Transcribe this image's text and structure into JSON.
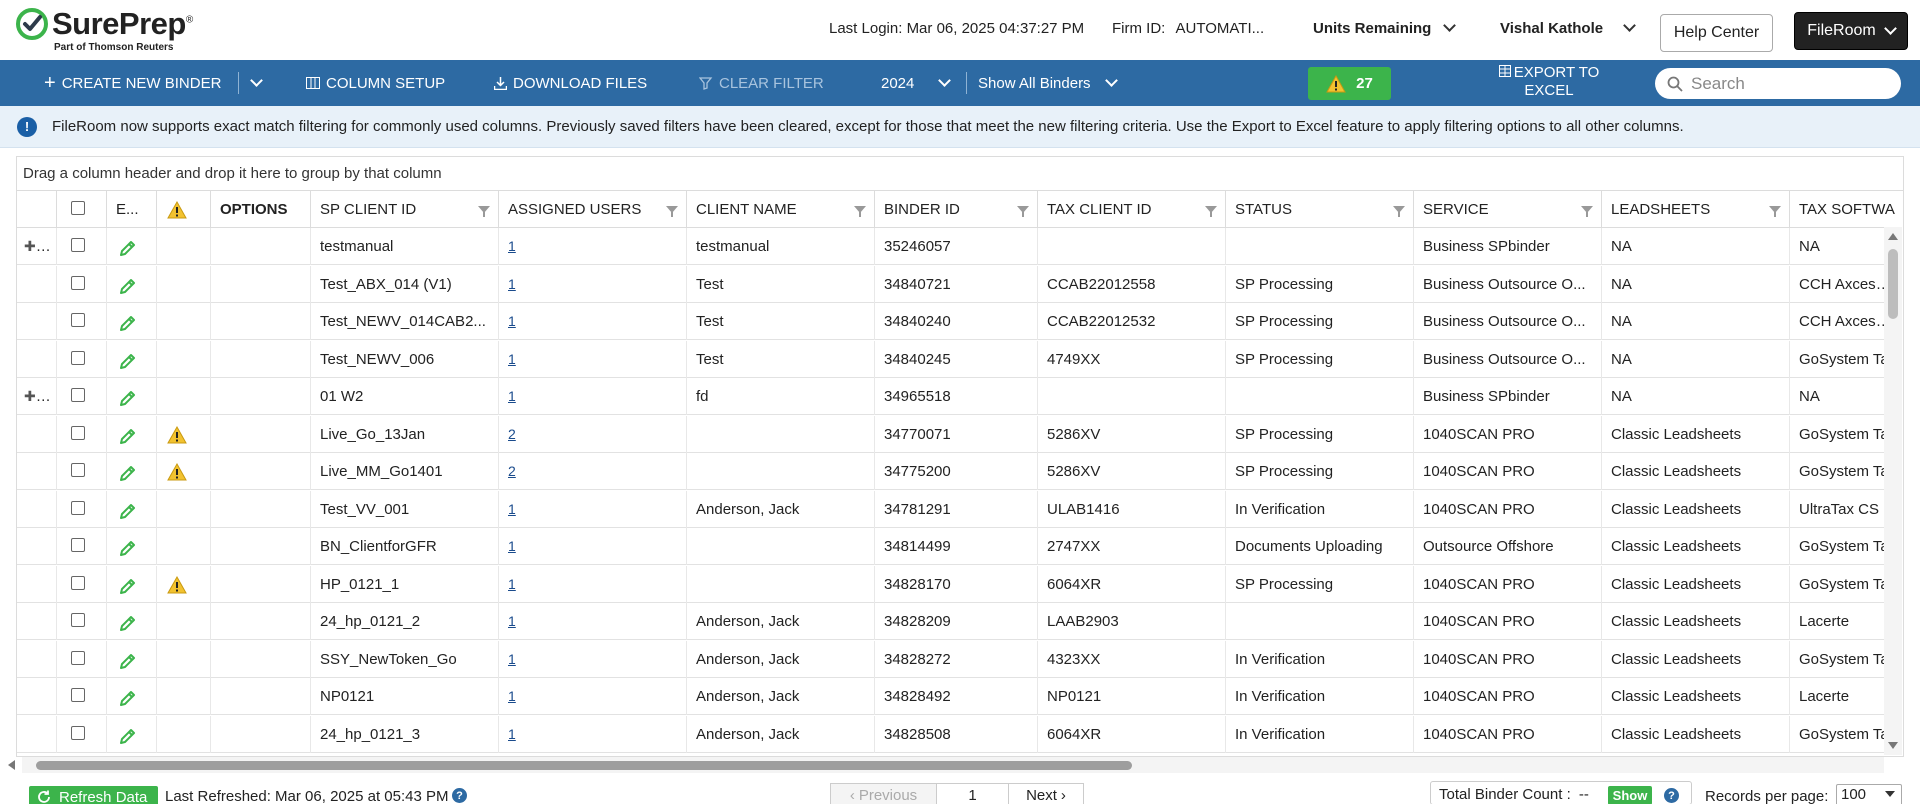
{
  "header": {
    "logo_text": "SurePrep",
    "logo_tagline": "Part of Thomson Reuters",
    "last_login_label": "Last Login:",
    "last_login_value": "Mar 06, 2025 04:37:27 PM",
    "firm_id_label": "Firm ID:",
    "firm_id_value": "AUTOMATI...",
    "units_remaining": "Units Remaining",
    "user_name": "Vishal Kathole",
    "help_center": "Help Center",
    "app_switcher": "FileRoom"
  },
  "toolbar": {
    "create_binder": "Create New Binder",
    "column_setup": "Column Setup",
    "download_files": "Download Files",
    "clear_filter": "Clear Filter",
    "year": "2024",
    "binder_filter": "Show All Binders",
    "warning_count": "27",
    "export_line1": "Export to",
    "export_line2": "Excel",
    "search_placeholder": "Search"
  },
  "banner": {
    "message": "FileRoom now supports exact match filtering for commonly used columns. Previously saved filters have been cleared, except for those that meet the new filtering criteria. Use the Export to Excel feature to apply filtering options to all other columns."
  },
  "grid": {
    "group_hint": "Drag a column header and drop it here to group by that column",
    "columns": {
      "edit": "E...",
      "options": "Options",
      "sp_client_id": "SP Client ID",
      "assigned_users": "Assigned Users",
      "client_name": "Client Name",
      "binder_id": "Binder ID",
      "tax_client_id": "Tax Client ID",
      "status": "Status",
      "service": "Service",
      "leadsheets": "Leadsheets",
      "tax_software": "Tax Softwa"
    },
    "rows": [
      {
        "expand": true,
        "warn": false,
        "sp_client_id": "testmanual",
        "assigned_users": "1",
        "client_name": "testmanual",
        "binder_id": "35246057",
        "tax_client_id": "",
        "status": "",
        "service": "Business SPbinder",
        "leadsheets": "NA",
        "tax_software": "NA"
      },
      {
        "expand": false,
        "warn": false,
        "sp_client_id": "Test_ABX_014 (V1)",
        "assigned_users": "1",
        "client_name": "Test",
        "binder_id": "34840721",
        "tax_client_id": "CCAB22012558",
        "status": "SP Processing",
        "service": "Business Outsource O...",
        "leadsheets": "NA",
        "tax_software": "CCH Axcess T"
      },
      {
        "expand": false,
        "warn": false,
        "sp_client_id": "Test_NEWV_014CAB2...",
        "assigned_users": "1",
        "client_name": "Test",
        "binder_id": "34840240",
        "tax_client_id": "CCAB22012532",
        "status": "SP Processing",
        "service": "Business Outsource O...",
        "leadsheets": "NA",
        "tax_software": "CCH Axcess T"
      },
      {
        "expand": false,
        "warn": false,
        "sp_client_id": "Test_NEWV_006",
        "assigned_users": "1",
        "client_name": "Test",
        "binder_id": "34840245",
        "tax_client_id": "4749XX",
        "status": "SP Processing",
        "service": "Business Outsource O...",
        "leadsheets": "NA",
        "tax_software": "GoSystem Ta"
      },
      {
        "expand": true,
        "warn": false,
        "sp_client_id": "01 W2",
        "assigned_users": "1",
        "client_name": "fd",
        "binder_id": "34965518",
        "tax_client_id": "",
        "status": "",
        "service": "Business SPbinder",
        "leadsheets": "NA",
        "tax_software": "NA"
      },
      {
        "expand": false,
        "warn": true,
        "sp_client_id": "Live_Go_13Jan",
        "assigned_users": "2",
        "client_name": "",
        "binder_id": "34770071",
        "tax_client_id": "5286XV",
        "status": "SP Processing",
        "service": "1040SCAN PRO",
        "leadsheets": "Classic Leadsheets",
        "tax_software": "GoSystem Ta"
      },
      {
        "expand": false,
        "warn": true,
        "sp_client_id": "Live_MM_Go1401",
        "assigned_users": "2",
        "client_name": "",
        "binder_id": "34775200",
        "tax_client_id": "5286XV",
        "status": "SP Processing",
        "service": "1040SCAN PRO",
        "leadsheets": "Classic Leadsheets",
        "tax_software": "GoSystem Ta"
      },
      {
        "expand": false,
        "warn": false,
        "sp_client_id": "Test_VV_001",
        "assigned_users": "1",
        "client_name": "Anderson, Jack",
        "binder_id": "34781291",
        "tax_client_id": "ULAB1416",
        "status": "In Verification",
        "service": "1040SCAN PRO",
        "leadsheets": "Classic Leadsheets",
        "tax_software": "UltraTax CS"
      },
      {
        "expand": false,
        "warn": false,
        "sp_client_id": "BN_ClientforGFR",
        "assigned_users": "1",
        "client_name": "",
        "binder_id": "34814499",
        "tax_client_id": "2747XX",
        "status": "Documents Uploading",
        "service": "Outsource Offshore",
        "leadsheets": "Classic Leadsheets",
        "tax_software": "GoSystem Ta"
      },
      {
        "expand": false,
        "warn": true,
        "sp_client_id": "HP_0121_1",
        "assigned_users": "1",
        "client_name": "",
        "binder_id": "34828170",
        "tax_client_id": "6064XR",
        "status": "SP Processing",
        "service": "1040SCAN PRO",
        "leadsheets": "Classic Leadsheets",
        "tax_software": "GoSystem Ta"
      },
      {
        "expand": false,
        "warn": false,
        "sp_client_id": "24_hp_0121_2",
        "assigned_users": "1",
        "client_name": "Anderson, Jack",
        "binder_id": "34828209",
        "tax_client_id": "LAAB2903",
        "status": "",
        "service": "1040SCAN PRO",
        "leadsheets": "Classic Leadsheets",
        "tax_software": "Lacerte"
      },
      {
        "expand": false,
        "warn": false,
        "sp_client_id": "SSY_NewToken_Go",
        "assigned_users": "1",
        "client_name": "Anderson, Jack",
        "binder_id": "34828272",
        "tax_client_id": "4323XX",
        "status": "In Verification",
        "service": "1040SCAN PRO",
        "leadsheets": "Classic Leadsheets",
        "tax_software": "GoSystem Ta"
      },
      {
        "expand": false,
        "warn": false,
        "sp_client_id": "NP0121",
        "assigned_users": "1",
        "client_name": "Anderson, Jack",
        "binder_id": "34828492",
        "tax_client_id": "NP0121",
        "status": "In Verification",
        "service": "1040SCAN PRO",
        "leadsheets": "Classic Leadsheets",
        "tax_software": "Lacerte"
      },
      {
        "expand": false,
        "warn": false,
        "sp_client_id": "24_hp_0121_3",
        "assigned_users": "1",
        "client_name": "Anderson, Jack",
        "binder_id": "34828508",
        "tax_client_id": "6064XR",
        "status": "In Verification",
        "service": "1040SCAN PRO",
        "leadsheets": "Classic Leadsheets",
        "tax_software": "GoSystem Ta"
      }
    ]
  },
  "footer": {
    "refresh_data": "Refresh Data",
    "last_refreshed": "Last Refreshed: Mar 06, 2025 at 05:43 PM",
    "previous": "Previous",
    "page_number": "1",
    "next": "Next",
    "total_binder_count_label": "Total Binder Count :",
    "total_binder_count_value": "--",
    "show": "Show",
    "records_per_page_label": "Records per page:",
    "records_per_page_value": "100"
  },
  "colors": {
    "toolbar_blue": "#2d6aa3",
    "success_green": "#3cb44b",
    "banner_bg": "#e8f1f9",
    "warning_yellow": "#f2c230",
    "pencil_green": "#3cb44b"
  },
  "icons": [
    "sureprep-logo-icon",
    "chevron-down-icon",
    "plus-icon",
    "columns-icon",
    "download-icon",
    "clear-filter-icon",
    "warning-icon",
    "excel-icon",
    "search-icon",
    "info-icon",
    "expand-icon",
    "checkbox-icon",
    "pencil-icon",
    "filter-icon",
    "refresh-icon",
    "help-icon"
  ]
}
